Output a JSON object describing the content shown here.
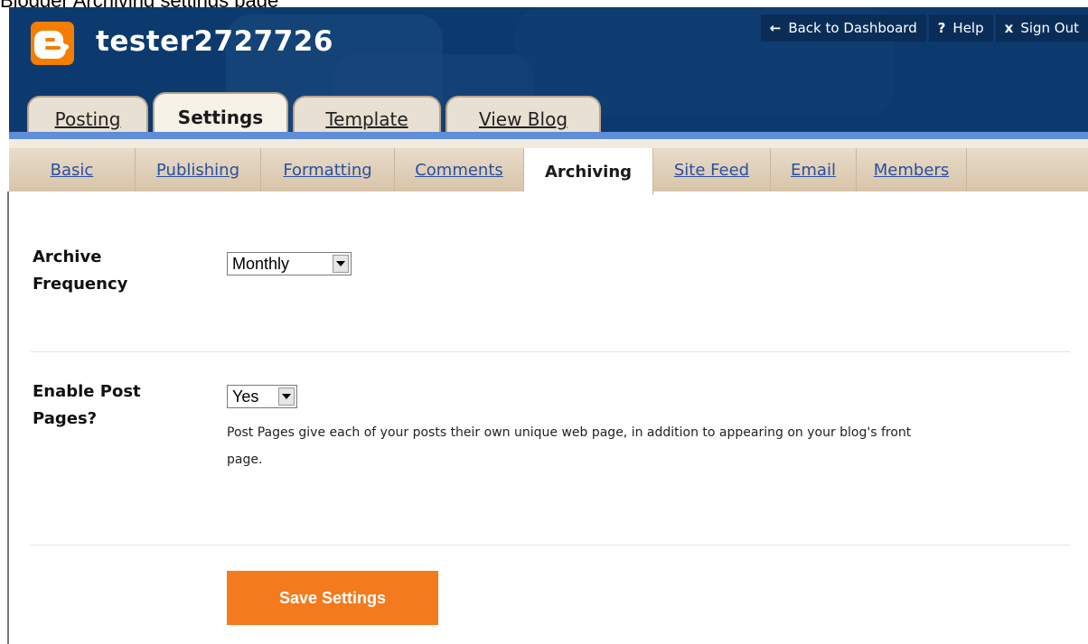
{
  "caption": "Blogger Archiving settings page",
  "blog_title": "tester2727726",
  "top_links": [
    {
      "icon": "←",
      "label": "Back to Dashboard"
    },
    {
      "icon": "?",
      "label": "Help"
    },
    {
      "icon": "x",
      "label": "Sign Out"
    }
  ],
  "tabs": [
    {
      "label": "Posting"
    },
    {
      "label": "Settings"
    },
    {
      "label": "Template"
    },
    {
      "label": "View Blog"
    }
  ],
  "subtabs": [
    {
      "label": "Basic"
    },
    {
      "label": "Publishing"
    },
    {
      "label": "Formatting"
    },
    {
      "label": "Comments"
    },
    {
      "label": "Archiving"
    },
    {
      "label": "Site Feed"
    },
    {
      "label": "Email"
    },
    {
      "label": "Members"
    }
  ],
  "form": {
    "archive_frequency": {
      "label_line1": "Archive",
      "label_line2": "Frequency",
      "value": "Monthly"
    },
    "post_pages": {
      "label_line1": "Enable Post",
      "label_line2": "Pages?",
      "value": "Yes",
      "help_line1": "Post Pages give each of your posts their own unique web page, in addition to appearing on your blog's front",
      "help_line2": "page."
    }
  },
  "save_label": "Save Settings",
  "colors": {
    "header": "#0d3a6e",
    "accent": "#f47a1e",
    "link": "#2a4fa0"
  }
}
